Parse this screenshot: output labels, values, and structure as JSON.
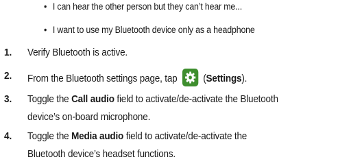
{
  "bullets": [
    "I can hear the other person but they can’t hear me...",
    "I want to use my Bluetooth device only as a headphone"
  ],
  "steps": {
    "s1": {
      "num": "1.",
      "text": "Verify Bluetooth is active."
    },
    "s2": {
      "num": "2.",
      "pre": "From the Bluetooth settings page, tap",
      "open": "(",
      "bold": "Settings",
      "close": ").",
      "icon": "settings-gear-icon"
    },
    "s3": {
      "num": "3.",
      "pre": "Toggle the",
      "bold": "Call audio",
      "post": "field to activate/de-activate the Bluetooth",
      "line2": "device’s on-board microphone."
    },
    "s4": {
      "num": "4.",
      "pre": "Toggle the",
      "bold": "Media audio",
      "post": "field to activate/de-activate the",
      "line2": "Bluetooth device’s headset functions."
    }
  },
  "colors": {
    "icon_bg": "#3e8e2e",
    "text": "#1a1a1a"
  }
}
